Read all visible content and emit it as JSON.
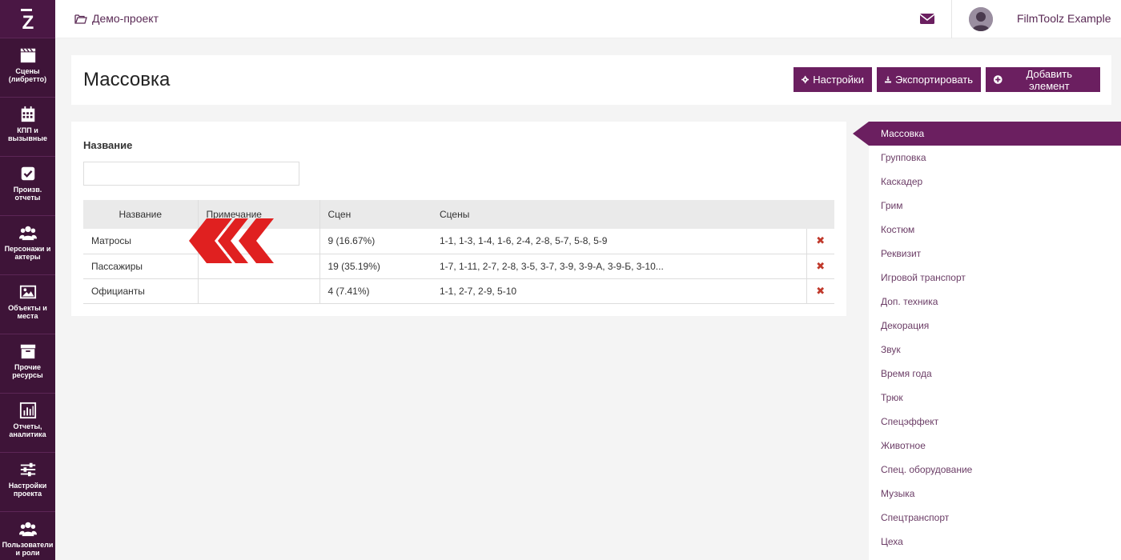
{
  "app": {
    "logo_letter": "Z"
  },
  "sidebar": {
    "items": [
      {
        "label": "Сцены (либретто)",
        "icon": "clapperboard-icon"
      },
      {
        "label": "КПП и вызывные",
        "icon": "calendar-icon"
      },
      {
        "label": "Произв. отчеты",
        "icon": "check-square-icon"
      },
      {
        "label": "Персонажи и актеры",
        "icon": "users-icon"
      },
      {
        "label": "Объекты и места",
        "icon": "image-icon"
      },
      {
        "label": "Прочие ресурсы",
        "icon": "archive-icon"
      },
      {
        "label": "Отчеты, аналитика",
        "icon": "bar-chart-icon"
      },
      {
        "label": "Настройки проекта",
        "icon": "sliders-icon"
      },
      {
        "label": "Пользователи и роли",
        "icon": "users-icon"
      }
    ]
  },
  "topbar": {
    "breadcrumb": "Демо-проект",
    "username": "FilmToolz Example"
  },
  "header": {
    "title": "Массовка",
    "settings_label": "Настройки",
    "export_label": "Экспортировать",
    "add_label": "Добавить элемент"
  },
  "filter": {
    "label": "Название",
    "value": ""
  },
  "table": {
    "columns": [
      "Название",
      "Примечание",
      "Сцен",
      "Сцены"
    ],
    "rows": [
      {
        "name": "Матросы",
        "note": "",
        "count": "9 (16.67%)",
        "scenes": "1-1, 1-3, 1-4, 1-6, 2-4, 2-8, 5-7, 5-8, 5-9"
      },
      {
        "name": "Пассажиры",
        "note": "",
        "count": "19 (35.19%)",
        "scenes": "1-7, 1-11, 2-7, 2-8, 3-5, 3-7, 3-9, 3-9-А, 3-9-Б, 3-10..."
      },
      {
        "name": "Официанты",
        "note": "",
        "count": "4 (7.41%)",
        "scenes": "1-1, 2-7, 2-9, 5-10"
      }
    ]
  },
  "categories": {
    "active": "Массовка",
    "items": [
      "Массовка",
      "Групповка",
      "Каскадер",
      "Грим",
      "Костюм",
      "Реквизит",
      "Игровой транспорт",
      "Доп. техника",
      "Декорация",
      "Звук",
      "Время года",
      "Трюк",
      "Спецэффект",
      "Животное",
      "Спец. оборудование",
      "Музыка",
      "Спецтранспорт",
      "Цеха"
    ]
  },
  "colors": {
    "accent": "#6b1f60",
    "sidebar": "#3e1438",
    "delete": "#c0392b"
  }
}
